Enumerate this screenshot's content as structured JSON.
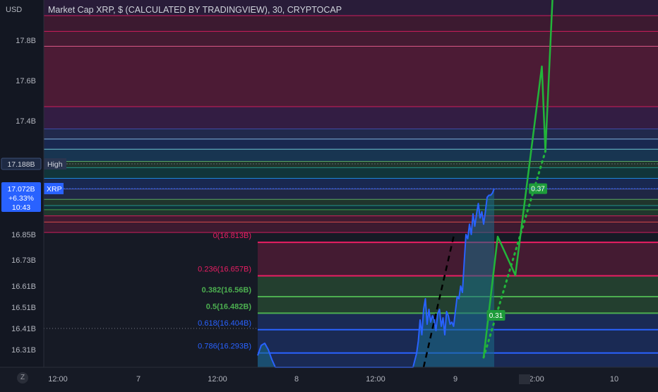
{
  "header": {
    "currency": "USD",
    "title": "Market Cap XRP, $ (CALCULATED BY TRADINGVIEW), 30, CRYPTOCAP"
  },
  "footer": {
    "zoom_label": "Z"
  },
  "colors": {
    "background": "#161a25",
    "price_line": "#2962ff",
    "price_area": "#1b6b86",
    "projection_green": "#22b53a",
    "fib_red": "#e91e63",
    "fib_green": "#4caf50",
    "fib_blue": "#2962ff",
    "axis_text": "#b2b5be"
  },
  "chart_data": {
    "type": "line",
    "title": "Market Cap XRP, $ (CALCULATED BY TRADINGVIEW), 30, CRYPTOCAP",
    "ylabel": "USD",
    "ylim": [
      16.22,
      17.98
    ],
    "y_ticks": [
      {
        "value": 17.8,
        "label": "17.8B"
      },
      {
        "value": 17.6,
        "label": "17.6B"
      },
      {
        "value": 17.4,
        "label": "17.4B"
      },
      {
        "value": 16.85,
        "label": "16.85B"
      },
      {
        "value": 16.73,
        "label": "16.73B"
      },
      {
        "value": 16.61,
        "label": "16.61B"
      },
      {
        "value": 16.51,
        "label": "16.51B"
      },
      {
        "value": 16.41,
        "label": "16.41B"
      },
      {
        "value": 16.31,
        "label": "16.31B"
      }
    ],
    "x_ticks": [
      "12:00",
      "7",
      "12:00",
      "8",
      "12:00",
      "9",
      "12:00",
      "10"
    ],
    "price_tags": [
      {
        "value": 17.188,
        "label": "17.188B",
        "tag": "High"
      },
      {
        "value": 17.072,
        "label": "17.072B",
        "tag": "XRP",
        "change": "+6.33%",
        "countdown": "10:43"
      }
    ],
    "series": [
      {
        "name": "XRP",
        "points": [
          [
            0.0,
            16.28
          ],
          [
            0.1,
            16.33
          ],
          [
            0.2,
            16.34
          ],
          [
            0.3,
            16.31
          ],
          [
            0.4,
            16.26
          ],
          [
            0.5,
            16.22
          ],
          [
            4.4,
            16.22
          ],
          [
            4.5,
            16.29
          ],
          [
            4.55,
            16.35
          ],
          [
            4.6,
            16.45
          ],
          [
            4.65,
            16.38
          ],
          [
            4.7,
            16.5
          ],
          [
            4.75,
            16.55
          ],
          [
            4.8,
            16.43
          ],
          [
            4.85,
            16.5
          ],
          [
            4.9,
            16.44
          ],
          [
            4.95,
            16.47
          ],
          [
            5.0,
            16.45
          ],
          [
            5.05,
            16.4
          ],
          [
            5.1,
            16.48
          ],
          [
            5.15,
            16.5
          ],
          [
            5.2,
            16.42
          ],
          [
            5.25,
            16.46
          ],
          [
            5.3,
            16.38
          ],
          [
            5.35,
            16.49
          ],
          [
            5.4,
            16.47
          ],
          [
            5.45,
            16.43
          ],
          [
            5.5,
            16.44
          ],
          [
            5.55,
            16.42
          ],
          [
            5.6,
            16.49
          ],
          [
            5.65,
            16.56
          ],
          [
            5.7,
            16.55
          ],
          [
            5.75,
            16.61
          ],
          [
            5.8,
            16.58
          ],
          [
            5.85,
            16.72
          ],
          [
            5.9,
            16.85
          ],
          [
            5.95,
            16.83
          ],
          [
            6.0,
            16.9
          ],
          [
            6.05,
            16.85
          ],
          [
            6.1,
            16.95
          ],
          [
            6.15,
            16.89
          ],
          [
            6.2,
            16.95
          ],
          [
            6.25,
            17.0
          ],
          [
            6.3,
            16.93
          ],
          [
            6.35,
            16.96
          ],
          [
            6.4,
            16.9
          ],
          [
            6.45,
            16.96
          ],
          [
            6.5,
            17.03
          ],
          [
            6.55,
            17.04
          ],
          [
            6.6,
            17.04
          ],
          [
            6.65,
            17.05
          ],
          [
            6.7,
            17.072
          ]
        ]
      }
    ],
    "projection": {
      "label_1": "0.31",
      "label_2": "0.37",
      "path": [
        [
          6.4,
          16.27
        ],
        [
          6.8,
          16.84
        ],
        [
          7.3,
          16.66
        ],
        [
          8.05,
          17.67
        ],
        [
          8.15,
          17.25
        ],
        [
          8.35,
          17.98
        ]
      ],
      "dotted": [
        [
          6.4,
          16.27
        ],
        [
          8.15,
          17.25
        ]
      ],
      "dashed_trend": [
        [
          4.7,
          16.22
        ],
        [
          5.55,
          16.84
        ]
      ]
    },
    "fibonacci": [
      {
        "label": "0(16.813B)",
        "value": 16.813,
        "color": "#e91e63",
        "fill": "rgba(233,30,99,0.22)"
      },
      {
        "label": "0.236(16.657B)",
        "value": 16.657,
        "color": "#e91e63",
        "fill": "rgba(76,175,80,0.25)"
      },
      {
        "label": "0.382(16.56B)",
        "value": 16.56,
        "color": "#4caf50",
        "fill": "rgba(76,175,80,0.25)"
      },
      {
        "label": "0.5(16.482B)",
        "value": 16.482,
        "color": "#4caf50",
        "fill": "rgba(41,98,255,0.22)"
      },
      {
        "label": "0.618(16.404B)",
        "value": 16.404,
        "color": "#2962ff",
        "fill": "rgba(41,98,255,0.22)"
      },
      {
        "label": "0.786(16.293B)",
        "value": 16.293,
        "color": "#2962ff",
        "fill": "rgba(41,98,255,0.22)"
      }
    ],
    "upper_levels": [
      17.91,
      17.84,
      17.77,
      17.47,
      17.36,
      17.31,
      17.26,
      17.2,
      17.17,
      17.12,
      17.07,
      17.02,
      16.99,
      16.97,
      16.94,
      16.91,
      16.86
    ]
  }
}
